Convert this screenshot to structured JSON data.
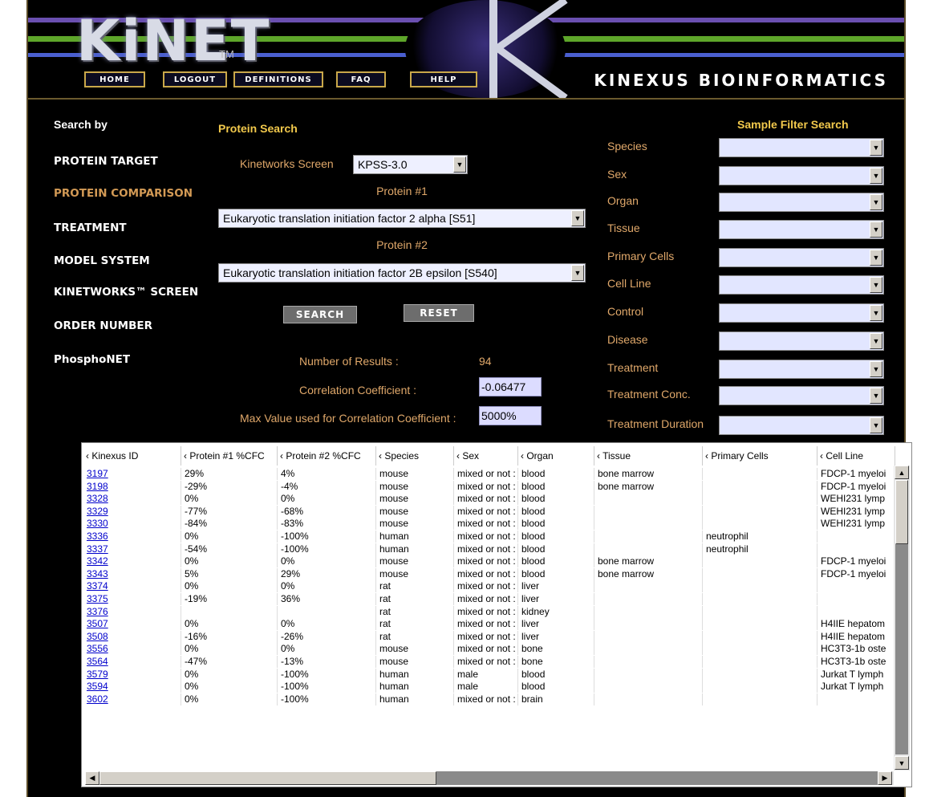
{
  "header": {
    "logo_text": "KiNET",
    "tm": "TM",
    "brand": "KINEXUS BIOINFORMATICS",
    "nav": [
      "HOME",
      "LOGOUT",
      "DEFINITIONS",
      "FAQ",
      "HELP"
    ]
  },
  "left": {
    "search_by": "Search by",
    "items": [
      "PROTEIN TARGET",
      "PROTEIN COMPARISON",
      "TREATMENT",
      "MODEL SYSTEM",
      "KINETWORKS™ SCREEN",
      "ORDER NUMBER",
      "PhosphoNET"
    ],
    "active_index": 1
  },
  "protein_search": {
    "title": "Protein Search",
    "screen_label": "Kinetworks Screen",
    "screen_value": "KPSS-3.0",
    "protein1_label": "Protein #1",
    "protein1_value": "Eukaryotic translation initiation factor 2 alpha [S51]",
    "protein2_label": "Protein #2",
    "protein2_value": "Eukaryotic translation initiation factor 2B epsilon [S540]",
    "search_button": "SEARCH",
    "reset_button": "RESET",
    "results_label": "Number of Results :",
    "results_value": "94",
    "corr_label": "Correlation Coefficient :",
    "corr_value": "-0.06477",
    "maxval_label": "Max Value used for Correlation Coefficient :",
    "maxval_value": "5000%"
  },
  "sample_filter": {
    "title": "Sample Filter Search",
    "fields": [
      "Species",
      "Sex",
      "Organ",
      "Tissue",
      "Primary Cells",
      "Cell Line",
      "Control",
      "Disease",
      "Treatment",
      "Treatment Conc.",
      "Treatment Duration"
    ]
  },
  "table": {
    "columns": [
      "‹ Kinexus ID",
      "‹ Protein #1 %CFC",
      "‹ Protein #2 %CFC",
      "‹ Species",
      "‹ Sex",
      "‹ Organ",
      "‹ Tissue",
      "‹ Primary Cells",
      "‹ Cell Line"
    ],
    "rows": [
      [
        "3197",
        "29%",
        "4%",
        "mouse",
        "mixed or not :",
        "blood",
        "bone marrow",
        "",
        "FDCP-1 myeloi"
      ],
      [
        "3198",
        "-29%",
        "-4%",
        "mouse",
        "mixed or not :",
        "blood",
        "bone marrow",
        "",
        "FDCP-1 myeloi"
      ],
      [
        "3328",
        "0%",
        "0%",
        "mouse",
        "mixed or not :",
        "blood",
        "",
        "",
        "WEHI231 lymp"
      ],
      [
        "3329",
        "-77%",
        "-68%",
        "mouse",
        "mixed or not :",
        "blood",
        "",
        "",
        "WEHI231 lymp"
      ],
      [
        "3330",
        "-84%",
        "-83%",
        "mouse",
        "mixed or not :",
        "blood",
        "",
        "",
        "WEHI231 lymp"
      ],
      [
        "3336",
        "0%",
        "-100%",
        "human",
        "mixed or not :",
        "blood",
        "",
        "neutrophil",
        ""
      ],
      [
        "3337",
        "-54%",
        "-100%",
        "human",
        "mixed or not :",
        "blood",
        "",
        "neutrophil",
        ""
      ],
      [
        "3342",
        "0%",
        "0%",
        "mouse",
        "mixed or not :",
        "blood",
        "bone marrow",
        "",
        "FDCP-1 myeloi"
      ],
      [
        "3343",
        "5%",
        "29%",
        "mouse",
        "mixed or not :",
        "blood",
        "bone marrow",
        "",
        "FDCP-1 myeloi"
      ],
      [
        "3374",
        "0%",
        "0%",
        "rat",
        "mixed or not :",
        "liver",
        "",
        "",
        ""
      ],
      [
        "3375",
        "-19%",
        "36%",
        "rat",
        "mixed or not :",
        "liver",
        "",
        "",
        ""
      ],
      [
        "3376",
        "",
        "",
        "rat",
        "mixed or not :",
        "kidney",
        "",
        "",
        ""
      ],
      [
        "3507",
        "0%",
        "0%",
        "rat",
        "mixed or not :",
        "liver",
        "",
        "",
        "H4IIE hepatom"
      ],
      [
        "3508",
        "-16%",
        "-26%",
        "rat",
        "mixed or not :",
        "liver",
        "",
        "",
        "H4IIE hepatom"
      ],
      [
        "3556",
        "0%",
        "0%",
        "mouse",
        "mixed or not :",
        "bone",
        "",
        "",
        "HC3T3-1b oste"
      ],
      [
        "3564",
        "-47%",
        "-13%",
        "mouse",
        "mixed or not :",
        "bone",
        "",
        "",
        "HC3T3-1b oste"
      ],
      [
        "3579",
        "0%",
        "-100%",
        "human",
        "male",
        "blood",
        "",
        "",
        "Jurkat T lymph"
      ],
      [
        "3594",
        "0%",
        "-100%",
        "human",
        "male",
        "blood",
        "",
        "",
        "Jurkat T lymph"
      ],
      [
        "3602",
        "0%",
        "-100%",
        "human",
        "mixed or not :",
        "brain",
        "",
        "",
        ""
      ]
    ]
  },
  "icons": {
    "dropdown": "chevron-down-icon",
    "scroll_up": "arrow-up-icon",
    "scroll_down": "arrow-down-icon",
    "scroll_left": "arrow-left-icon",
    "scroll_right": "arrow-right-icon"
  },
  "colors": {
    "gold": "#f2c94c",
    "tan": "#d39a55",
    "select_bg": "#e2e6ff",
    "value_bg": "#dcdcff"
  }
}
